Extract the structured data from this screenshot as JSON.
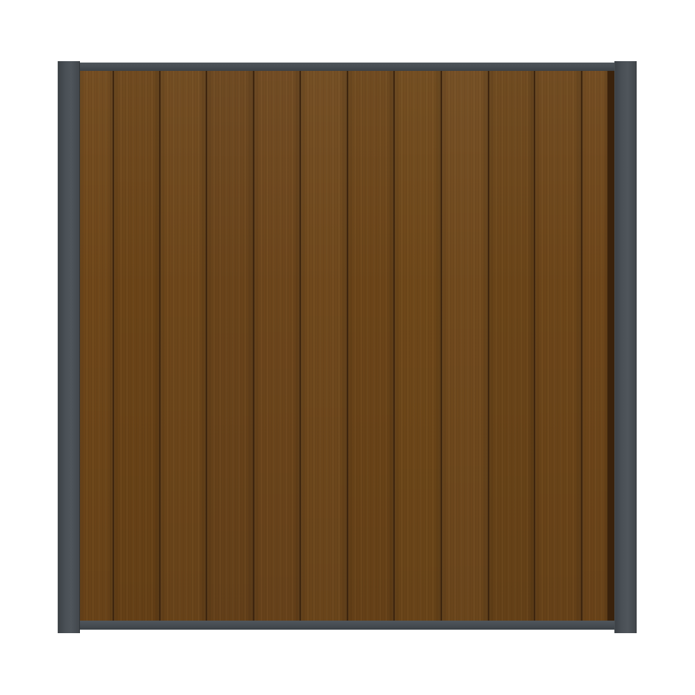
{
  "image": {
    "subject": "fence-panel",
    "board_count": 12,
    "colors": {
      "background": "#ffffff",
      "frame": "#474d53",
      "boards": [
        "#6e4619",
        "#6a4317",
        "#6d461a",
        "#69431a",
        "#6c451b",
        "#6f481c",
        "#6b4418",
        "#6e4719",
        "#70491d",
        "#6a4418",
        "#6c4519",
        "#6e461a"
      ],
      "seam": "#3d250f"
    }
  }
}
